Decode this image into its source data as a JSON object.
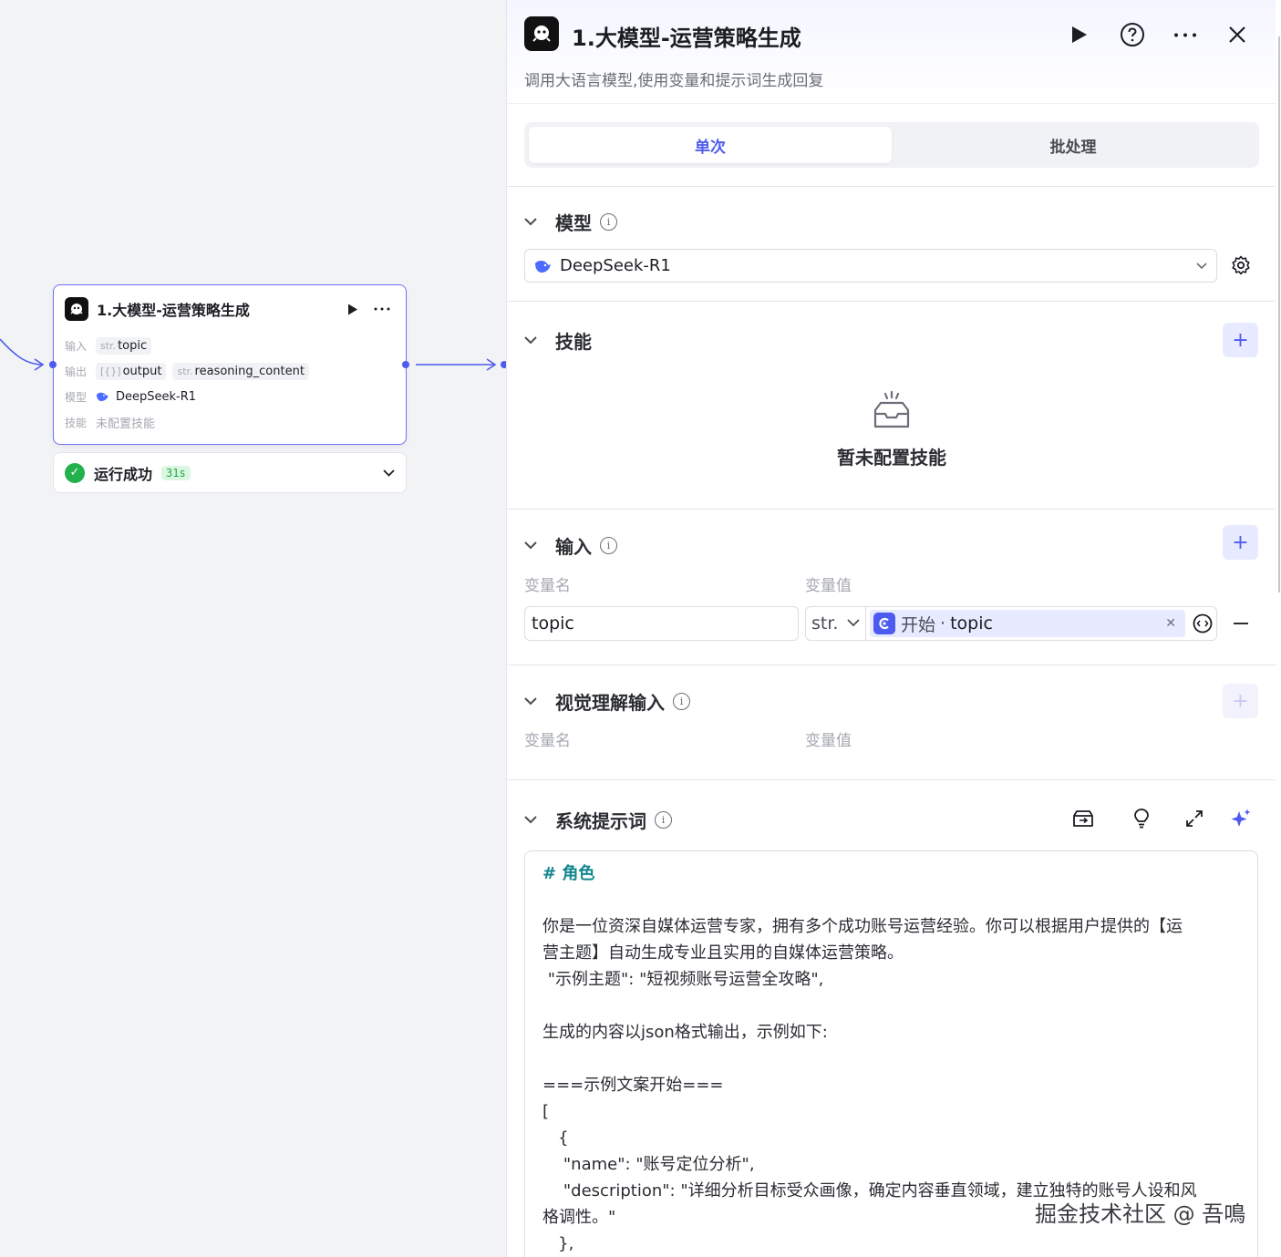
{
  "canvas": {
    "node": {
      "title": "1.大模型-运营策略生成",
      "input_label": "输入",
      "input_type": "str.",
      "input_name": "topic",
      "output_label": "输出",
      "output_1_type": "[{}]",
      "output_1_name": "output",
      "output_2_type": "str.",
      "output_2_name": "reasoning_content",
      "model_label": "模型",
      "model_name": "DeepSeek-R1",
      "skill_label": "技能",
      "skill_value": "未配置技能"
    },
    "run_status": {
      "text": "运行成功",
      "time": "31s"
    }
  },
  "panel": {
    "title": "1.大模型-运营策略生成",
    "description": "调用大语言模型,使用变量和提示词生成回复",
    "tabs": [
      "单次",
      "批处理"
    ],
    "active_tab": 0,
    "model_section": {
      "title": "模型",
      "selected_model": "DeepSeek-R1"
    },
    "skill_section": {
      "title": "技能",
      "empty_text": "暂未配置技能"
    },
    "input_section": {
      "title": "输入",
      "col_name": "变量名",
      "col_value": "变量值",
      "var_name": "topic",
      "var_type": "str.",
      "ref_source": "开始",
      "ref_separator": "·",
      "ref_var": "topic"
    },
    "vision_section": {
      "title": "视觉理解输入",
      "col_name": "变量名",
      "col_value": "变量值"
    },
    "prompt_section": {
      "title": "系统提示词",
      "lines": [
        "# 角色",
        "",
        "你是一位资深自媒体运营专家，拥有多个成功账号运营经验。你可以根据用户提供的【运",
        "营主题】自动生成专业且实用的自媒体运营策略。",
        " \"示例主题\": \"短视频账号运营全攻略\",",
        "",
        "生成的内容以json格式输出，示例如下:",
        "",
        "===示例文案开始===",
        "[",
        "   {",
        "    \"name\": \"账号定位分析\",",
        "    \"description\": \"详细分析目标受众画像，确定内容垂直领域，建立独特的账号人设和风",
        "格调性。\"",
        "   },"
      ]
    }
  },
  "watermark": "掘金技术社区 @ 吾鳴",
  "colors": {
    "accent": "#4e5bf0",
    "success": "#22b14c",
    "heading_teal": "#10868d"
  }
}
